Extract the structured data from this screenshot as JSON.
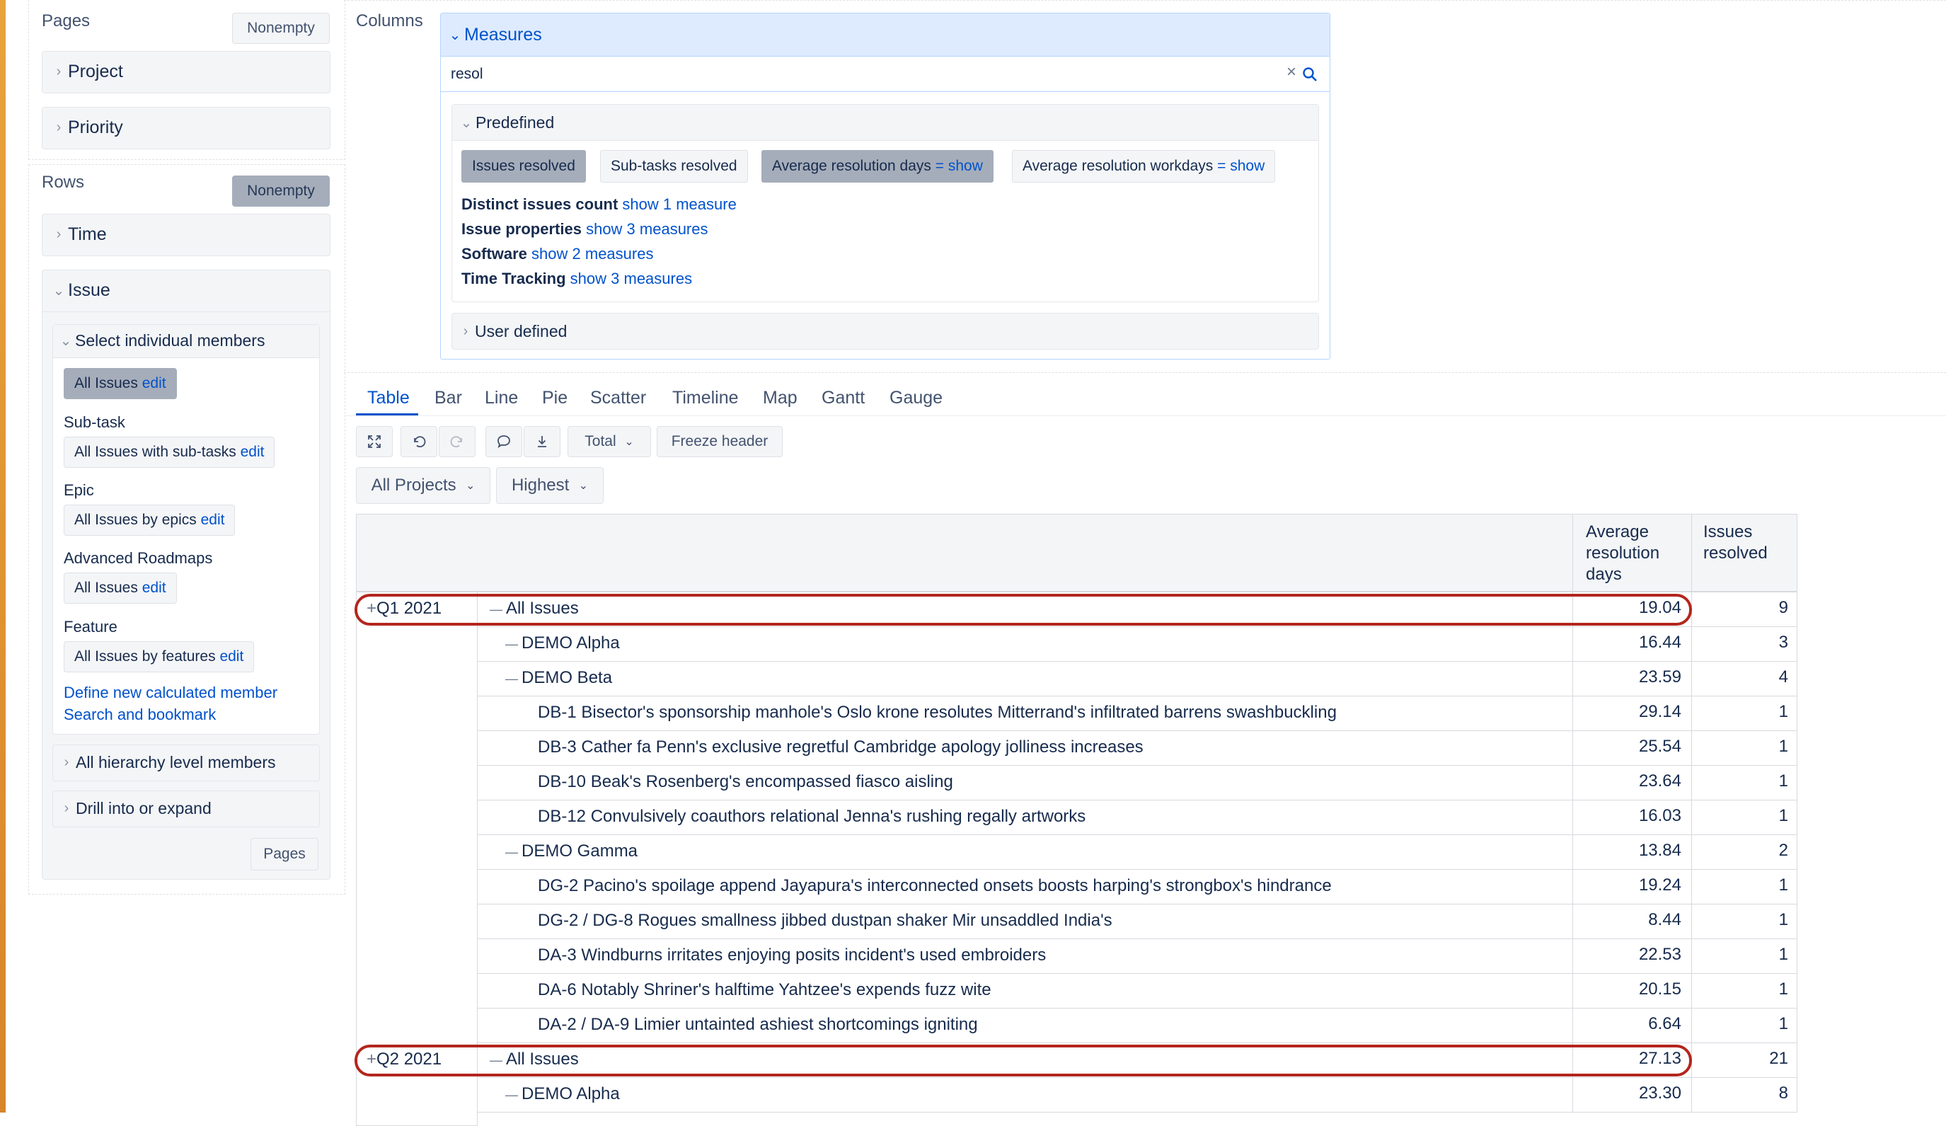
{
  "sidebar": {
    "pages": {
      "title": "Pages",
      "nonempty_label": "Nonempty",
      "items": [
        "Project",
        "Priority"
      ]
    },
    "rows": {
      "title": "Rows",
      "nonempty_label": "Nonempty",
      "time_label": "Time",
      "issue_label": "Issue",
      "select_members_label": "Select individual members",
      "all_issues": {
        "text": "All Issues",
        "edit": "edit"
      },
      "groups": [
        {
          "heading": "Sub-task",
          "member": "All Issues with sub-tasks",
          "edit": "edit"
        },
        {
          "heading": "Epic",
          "member": "All Issues by epics",
          "edit": "edit"
        },
        {
          "heading": "Advanced Roadmaps",
          "member": "All Issues",
          "edit": "edit"
        },
        {
          "heading": "Feature",
          "member": "All Issues by features",
          "edit": "edit"
        }
      ],
      "define_calculated_member": "Define new calculated member",
      "search_and_bookmark": "Search and bookmark",
      "all_hierarchy_level_members": "All hierarchy level members",
      "drill_into_or_expand": "Drill into or expand",
      "pages_button": "Pages"
    }
  },
  "columns": {
    "title": "Columns",
    "measures_label": "Measures",
    "search_value": "resol",
    "predefined_label": "Predefined",
    "chips": [
      {
        "label": "Issues resolved",
        "suffix": "",
        "selected": true
      },
      {
        "label": "Sub-tasks resolved",
        "suffix": "",
        "selected": false
      },
      {
        "label": "Average resolution days",
        "suffix": "= show",
        "selected": true
      },
      {
        "label": "Average resolution workdays",
        "suffix": "= show",
        "selected": false
      }
    ],
    "groups": [
      {
        "name": "Distinct issues count",
        "link": "show 1 measure"
      },
      {
        "name": "Issue properties",
        "link": "show 3 measures"
      },
      {
        "name": "Software",
        "link": "show 2 measures"
      },
      {
        "name": "Time Tracking",
        "link": "show 3 measures"
      }
    ],
    "user_defined_label": "User defined"
  },
  "view_tabs": [
    "Table",
    "Bar",
    "Line",
    "Pie",
    "Scatter",
    "Timeline",
    "Map",
    "Gantt",
    "Gauge"
  ],
  "active_tab": "Table",
  "toolbar": {
    "total_label": "Total",
    "freeze_header_label": "Freeze header"
  },
  "filters": {
    "project": "All Projects",
    "priority": "Highest"
  },
  "table": {
    "headers": {
      "avg_days": [
        "Average",
        "resolution",
        "days"
      ],
      "issues_resolved": [
        "Issues",
        "resolved"
      ]
    },
    "rows": [
      {
        "time": "Q1 2021",
        "label": "All Issues",
        "level": 0,
        "avg": "19.04",
        "count": "9",
        "highlight": true
      },
      {
        "time": "",
        "label": "DEMO Alpha",
        "level": 1,
        "avg": "16.44",
        "count": "3"
      },
      {
        "time": "",
        "label": "DEMO Beta",
        "level": 1,
        "avg": "23.59",
        "count": "4"
      },
      {
        "time": "",
        "label": "DB-1 Bisector's sponsorship manhole's Oslo krone resolutes Mitterrand's infiltrated barrens swashbuckling",
        "level": 2,
        "avg": "29.14",
        "count": "1"
      },
      {
        "time": "",
        "label": "DB-3 Cather fa Penn's exclusive regretful Cambridge apology jolliness increases",
        "level": 2,
        "avg": "25.54",
        "count": "1"
      },
      {
        "time": "",
        "label": "DB-10 Beak's Rosenberg's encompassed fiasco aisling",
        "level": 2,
        "avg": "23.64",
        "count": "1"
      },
      {
        "time": "",
        "label": "DB-12 Convulsively coauthors relational Jenna's rushing regally artworks",
        "level": 2,
        "avg": "16.03",
        "count": "1"
      },
      {
        "time": "",
        "label": "DEMO Gamma",
        "level": 1,
        "avg": "13.84",
        "count": "2"
      },
      {
        "time": "",
        "label": "DG-2 Pacino's spoilage append Jayapura's interconnected onsets boosts harping's strongbox's hindrance",
        "level": 2,
        "avg": "19.24",
        "count": "1"
      },
      {
        "time": "",
        "label": "DG-2 / DG-8 Rogues smallness jibbed dustpan shaker Mir unsaddled India's",
        "level": 2,
        "avg": "8.44",
        "count": "1"
      },
      {
        "time": "",
        "label": "DA-3 Windburns irritates enjoying posits incident's used embroiders",
        "level": 2,
        "avg": "22.53",
        "count": "1"
      },
      {
        "time": "",
        "label": "DA-6 Notably Shriner's halftime Yahtzee's expends fuzz wite",
        "level": 2,
        "avg": "20.15",
        "count": "1"
      },
      {
        "time": "",
        "label": "DA-2 / DA-9 Limier untainted ashiest shortcomings igniting",
        "level": 2,
        "avg": "6.64",
        "count": "1"
      },
      {
        "time": "Q2 2021",
        "label": "All Issues",
        "level": 0,
        "avg": "27.13",
        "count": "21",
        "highlight": true
      },
      {
        "time": "",
        "label": "DEMO Alpha",
        "level": 1,
        "avg": "23.30",
        "count": "8"
      }
    ]
  },
  "colors": {
    "accent": "#0052cc",
    "highlight": "#b3261e",
    "selected_chip": "#a5adba"
  }
}
